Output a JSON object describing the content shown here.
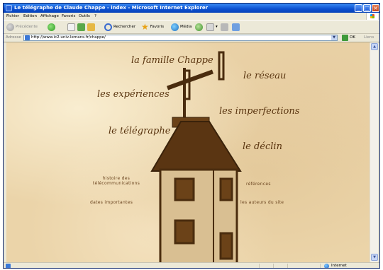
{
  "window": {
    "title": "Le télégraphe de Claude Chappe - index - Microsoft Internet Explorer",
    "minimize": "_",
    "maximize": "□",
    "close": "×"
  },
  "menu": {
    "items": [
      "Fichier",
      "Edition",
      "Affichage",
      "Favoris",
      "Outils",
      "?"
    ]
  },
  "toolbar": {
    "back": "Précédente",
    "search": "Rechercher",
    "favorites": "Favoris",
    "media": "Média"
  },
  "address": {
    "label": "Adresse",
    "url": "http://www.ic2.univ-lemans.fr/chappe/",
    "go": "OK",
    "links": "Liens"
  },
  "page": {
    "links": {
      "famille": "la famille Chappe",
      "reseau": "le réseau",
      "experiences": "les expériences",
      "imperfections": "les imperfections",
      "telegraphe": "le télégraphe",
      "declin": "le déclin",
      "histoire_line1": "histoire des",
      "histoire_line2": "télécommunications",
      "references": "références",
      "dates": "dates importantes",
      "auteurs": "les auteurs du site"
    }
  },
  "status": {
    "zone": "Internet"
  },
  "colors": {
    "parchment": "#ebd4a9",
    "ink": "#5a3510",
    "tower_wall": "#d9bf92",
    "roof": "#4a2c0e"
  },
  "icons": {
    "back": "back-arrow-icon",
    "forward": "forward-arrow-icon",
    "stop": "stop-icon",
    "refresh": "refresh-icon",
    "home": "home-icon",
    "search": "search-icon",
    "favorites": "star-icon",
    "media": "media-icon",
    "history": "history-icon",
    "mail": "mail-icon",
    "print": "printer-icon",
    "edit": "edit-icon"
  }
}
